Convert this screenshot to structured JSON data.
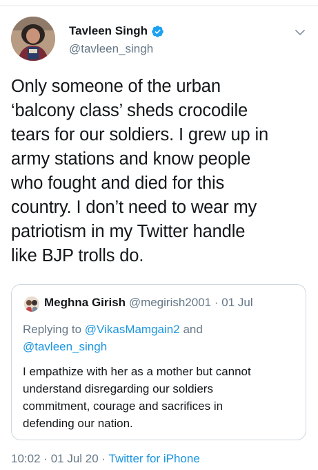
{
  "tweet": {
    "author_name": "Tavleen Singh",
    "author_handle": "@tavleen_singh",
    "verified": true,
    "text_lines": [
      "Only someone of the urban",
      "‘balcony class’ sheds crocodile",
      "tears for our soldiers. I grew up in",
      "army stations and know people",
      "who fought and died for this",
      "country. I don’t need to wear my",
      "patriotism in my Twitter handle",
      "like BJP trolls do."
    ],
    "time": "10:02",
    "date": "01 Jul 20",
    "source": "Twitter for iPhone",
    "separator": "·"
  },
  "quote": {
    "author_name": "Meghna Girish",
    "author_handle": "@megirish2001",
    "date": "01 Jul",
    "separator": "·",
    "replying_prefix": "Replying to",
    "replying_user1": "@VikasMamgain2",
    "replying_and": "and",
    "replying_user2": "@tavleen_singh",
    "text_lines": [
      "I empathize with her as a mother but cannot",
      "understand disregarding our soldiers",
      "commitment, courage and sacrifices in",
      "defending our nation."
    ]
  },
  "colors": {
    "link": "#1b95e0",
    "secondary_text": "#657786",
    "primary_text": "#14171a",
    "verified_badge": "#1da1f2",
    "border": "#ccd6dd"
  },
  "icons": {
    "verified": "verified-badge-icon",
    "menu": "chevron-down-icon"
  }
}
